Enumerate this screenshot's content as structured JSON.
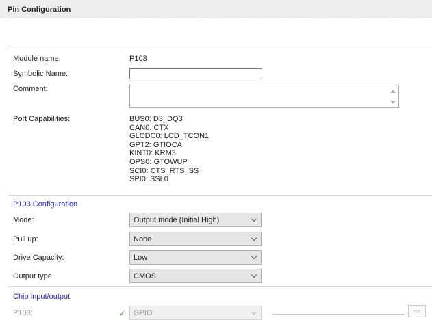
{
  "panel": {
    "title": "Pin Configuration"
  },
  "fields": {
    "module_name_label": "Module name:",
    "module_name_value": "P103",
    "symbolic_name_label": "Symbolic Name:",
    "symbolic_name_value": "",
    "comment_label": "Comment:",
    "comment_value": "",
    "port_capabilities_label": "Port Capabilities:",
    "port_capabilities": [
      "BUS0: D3_DQ3",
      "CAN0: CTX",
      "GLCDC0: LCD_TCON1",
      "GPT2: GTIOCA",
      "KINT0: KRM3",
      "OPS0: GTOWUP",
      "SCI0: CTS_RTS_SS",
      "SPI0: SSL0"
    ]
  },
  "configuration": {
    "section_title": "P103 Configuration",
    "rows": [
      {
        "label": "Mode:",
        "value": "Output mode (Initial High)"
      },
      {
        "label": "Pull up:",
        "value": "None"
      },
      {
        "label": "Drive Capacity:",
        "value": "Low"
      },
      {
        "label": "Output type:",
        "value": "CMOS"
      }
    ]
  },
  "chip_io": {
    "section_title": "Chip input/output",
    "pin_label": "P103:",
    "pin_value": "GPIO",
    "status": "ok",
    "check_glyph": "✓",
    "arrow_glyph": "⇨"
  }
}
